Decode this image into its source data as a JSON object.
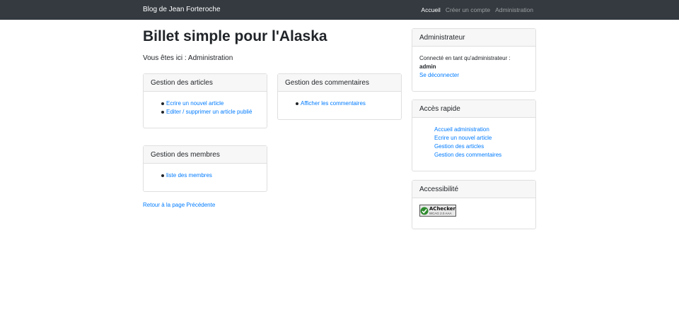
{
  "navbar": {
    "brand": "Blog de Jean Forteroche",
    "links": [
      {
        "label": "Accueil"
      },
      {
        "label": "Créer un compte"
      },
      {
        "label": "Administration"
      }
    ]
  },
  "page": {
    "title": "Billet simple pour l'Alaska",
    "breadcrumb": "Vous êtes ici : Administration",
    "back_link": "Retour à la page Précédente"
  },
  "cards": {
    "articles": {
      "header": "Gestion des articles",
      "items": [
        "Ecrire un nouvel article",
        "Editer / supprimer un article publié"
      ]
    },
    "comments": {
      "header": "Gestion des commentaires",
      "items": [
        "Afficher les commentaires"
      ]
    },
    "members": {
      "header": "Gestion des membres",
      "items": [
        "liste des membres"
      ]
    }
  },
  "sidebar": {
    "admin": {
      "header": "Administrateur",
      "connected_text": "Connecté en tant qu'administrateur :",
      "username": "admin",
      "logout": "Se déconnecter"
    },
    "quick": {
      "header": "Accès rapide",
      "items": [
        "Accueil administration",
        "Ecrire un nouvel article",
        "Gestion des articles",
        "Gestion des commentaires"
      ]
    },
    "accessibility": {
      "header": "Accessibilité",
      "badge_title": "AChecker",
      "badge_subtitle": "WCAG 2.0 AAA",
      "icon": "check-icon"
    }
  },
  "colors": {
    "navbar_bg": "#343a40",
    "link": "#007bff",
    "card_header_bg": "#f7f7f7",
    "card_border": "#dfdfdf"
  }
}
